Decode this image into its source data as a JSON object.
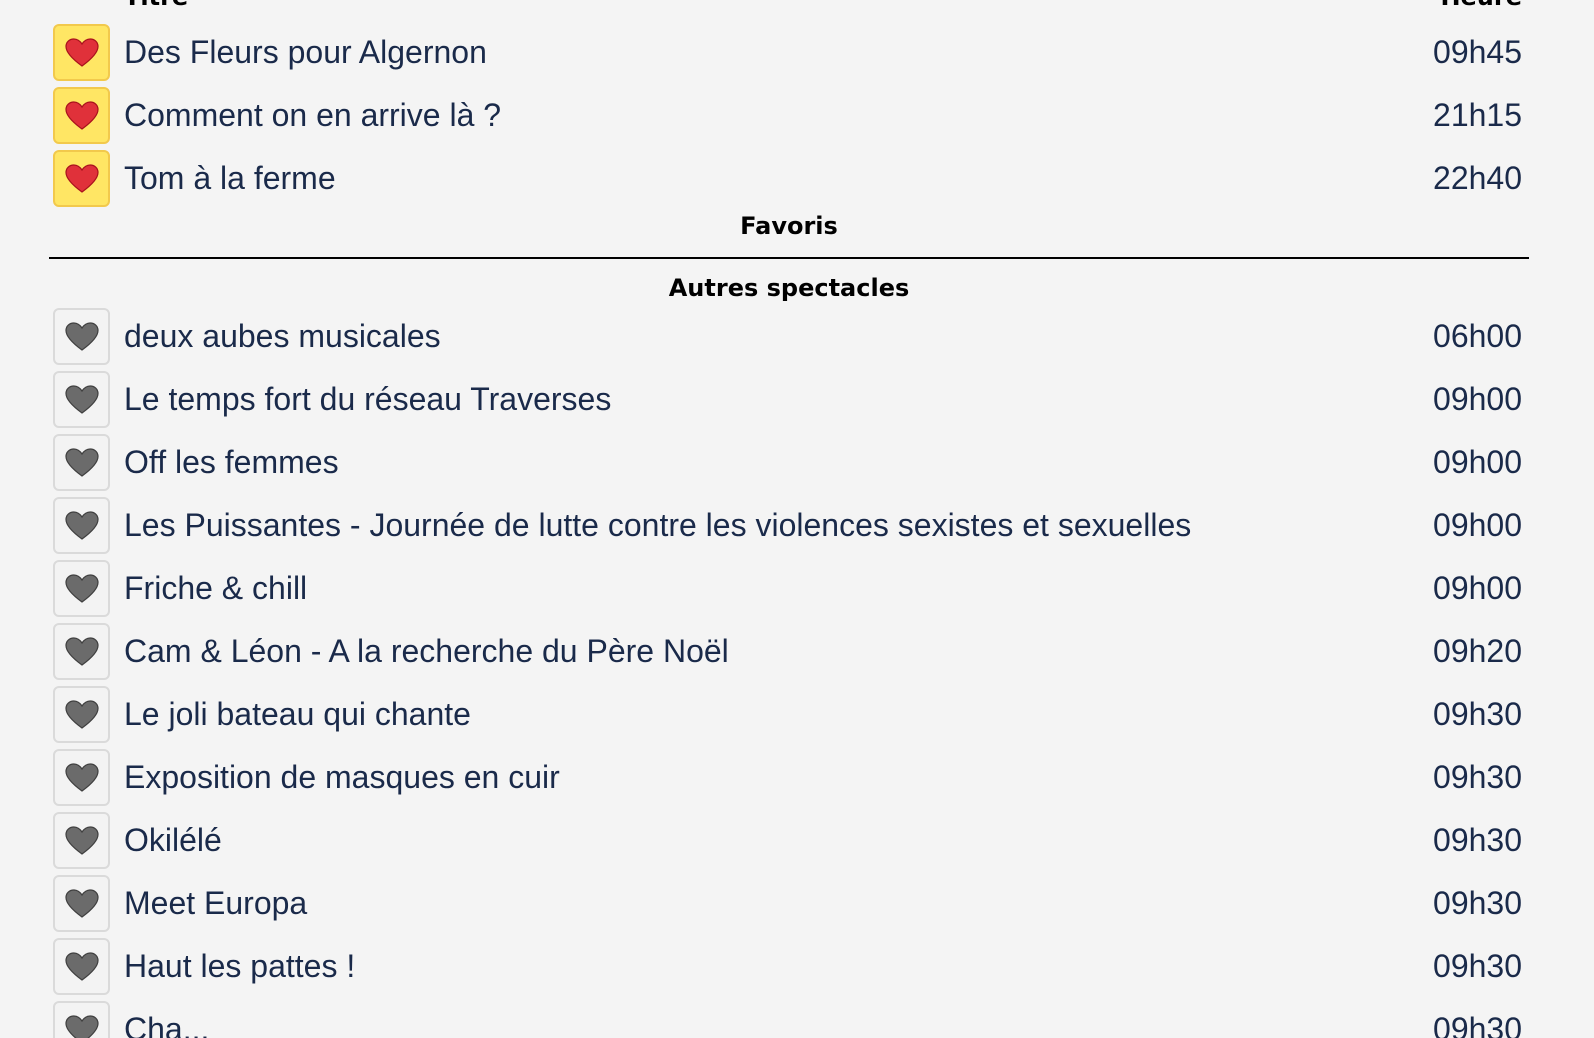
{
  "header": {
    "title_col": "Titre",
    "hour_col": "Heure"
  },
  "favorites": {
    "label": "Favoris",
    "items": [
      {
        "title": "Des Fleurs pour Algernon",
        "time": "09h45"
      },
      {
        "title": "Comment on en arrive là ?",
        "time": "21h15"
      },
      {
        "title": "Tom à la ferme",
        "time": "22h40"
      }
    ]
  },
  "others": {
    "label": "Autres spectacles",
    "items": [
      {
        "title": "deux aubes musicales",
        "time": "06h00"
      },
      {
        "title": "Le temps fort du réseau Traverses",
        "time": "09h00"
      },
      {
        "title": "Off les femmes",
        "time": "09h00"
      },
      {
        "title": "Les Puissantes - Journée de lutte contre les violences sexistes et sexuelles",
        "time": "09h00"
      },
      {
        "title": "Friche & chill",
        "time": "09h00"
      },
      {
        "title": "Cam & Léon - A la recherche du Père Noël",
        "time": "09h20"
      },
      {
        "title": "Le joli bateau qui chante",
        "time": "09h30"
      },
      {
        "title": "Exposition de masques en cuir",
        "time": "09h30"
      },
      {
        "title": "Okilélé",
        "time": "09h30"
      },
      {
        "title": "Meet Europa",
        "time": "09h30"
      },
      {
        "title": "Haut les pattes !",
        "time": "09h30"
      },
      {
        "title": "Cha...",
        "time": "09h30"
      }
    ]
  },
  "icons": {
    "favorite_on": "red-heart-icon",
    "favorite_off": "grey-heart-icon"
  },
  "colors": {
    "favorite_bg": "#ffe664",
    "heart_red": "#e0313a",
    "heart_grey": "#6b6b6b",
    "text": "#1a2a4a"
  }
}
